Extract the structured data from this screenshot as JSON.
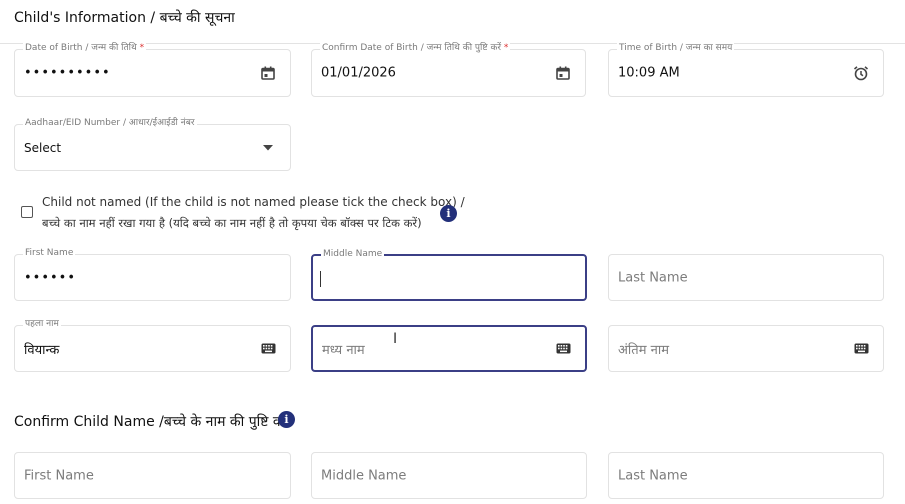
{
  "header": {
    "title": "Child's Information / बच्चे की सूचना"
  },
  "row1": {
    "dob": {
      "label": "Date of Birth / जन्म की तिथि",
      "required": "*",
      "value": "••••••••••",
      "icon": "calendar-icon"
    },
    "confirm_dob": {
      "label": "Confirm Date of Birth / जन्म तिथि की पुष्टि करें",
      "required": "*",
      "value": "01/01/2026",
      "icon": "calendar-icon"
    },
    "tob": {
      "label": "Time of Birth / जन्म का समय",
      "value": "10:09 AM",
      "icon": "alarm-clock-icon"
    }
  },
  "aadhaar": {
    "label": "Aadhaar/EID Number / आधार/ईआईडी नंबर",
    "value": "Select",
    "icon": "dropdown-arrow-icon"
  },
  "child_not_named": {
    "line1": "Child not named (If the child is not named please tick the check box) /",
    "line2": "बच्चे का नाम नहीं रखा गया है (यदि बच्चे का नाम नहीं है तो कृपया चेक बॉक्स पर टिक करें)",
    "info_glyph": "i"
  },
  "names_en": {
    "first": {
      "label": "First Name",
      "value": "••••••"
    },
    "middle": {
      "label": "Middle Name",
      "value": ""
    },
    "last": {
      "placeholder": "Last Name"
    }
  },
  "names_hi": {
    "first": {
      "label": "पहला नाम",
      "value": "वियान्क",
      "icon": "keyboard-icon"
    },
    "middle": {
      "placeholder": "मध्य नाम",
      "icon": "keyboard-icon"
    },
    "last": {
      "placeholder": "अंतिम नाम",
      "icon": "keyboard-icon"
    }
  },
  "confirm_section": {
    "title": "Confirm Child Name /बच्चे के नाम की पुष्टि करें",
    "info_glyph": "i",
    "first_placeholder": "First Name",
    "middle_placeholder": "Middle Name",
    "last_placeholder": "Last Name"
  },
  "colors": {
    "accent": "#3b3f86",
    "info": "#23307a",
    "required": "#d33333"
  }
}
